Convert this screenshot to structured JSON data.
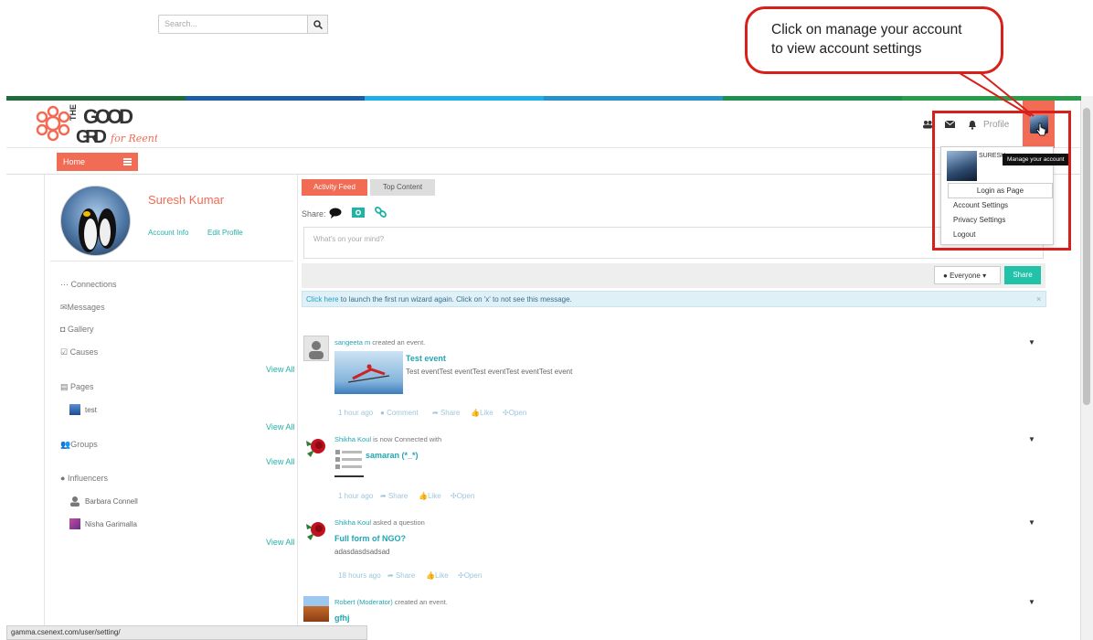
{
  "callout": {
    "line1": "Click on manage your account",
    "line2": "to view account settings"
  },
  "brand": {
    "accent": "#f26b55",
    "teal": "#21b2a6",
    "topbar_colors": [
      "#1f7a3f",
      "#1a5fa0",
      "#1db0e6",
      "#22a0c6",
      "#1f8f4f",
      "#26a14c"
    ]
  },
  "header": {
    "search_placeholder": "Search...",
    "profile_label": "Profile",
    "icons": [
      "users-icon",
      "envelope-icon",
      "bell-icon"
    ]
  },
  "nav": {
    "home_label": "Home"
  },
  "user": {
    "name": "Suresh Kumar",
    "account_info": "Account Info",
    "edit_profile": "Edit Profile"
  },
  "sidebar": {
    "connections": "Connections",
    "messages": "Messages",
    "gallery": "Gallery",
    "causes": "Causes",
    "view_all": "View All",
    "pages": "Pages",
    "page_item": "test",
    "groups": "Groups",
    "influencers": "Influencers",
    "influencer_1": "Barbara Connell",
    "influencer_2": "Nisha Garimalla"
  },
  "tabs": {
    "activity": "Activity Feed",
    "top": "Top Content"
  },
  "composer": {
    "share_label": "Share:",
    "placeholder": "What's on your mind?",
    "audience": "Everyone",
    "share_button": "Share"
  },
  "alert": {
    "link": "Click here",
    "text": " to launch the first run wizard again. Click on 'x' to not see this message.",
    "close": "×"
  },
  "feed": [
    {
      "user": "sangeeta m",
      "action": " created an event.",
      "title": "Test event",
      "text": "Test eventTest eventTest eventTest eventTest event",
      "time": "1 hour ago",
      "comment": "Comment",
      "share": "Share",
      "like": "Like",
      "open": "Open"
    },
    {
      "user": "Shikha Koul",
      "action": " is now Connected with",
      "title": "samaran (*_*)",
      "time": "1 hour ago",
      "share": "Share",
      "like": "Like",
      "open": "Open"
    },
    {
      "user": "Shikha Koul",
      "action": " asked a question",
      "title": "Full form of NGO?",
      "text": "adasdasdsadsad",
      "time": "18 hours ago",
      "share": "Share",
      "like": "Like",
      "open": "Open"
    },
    {
      "user": "Robert (Moderator)",
      "action": " created an event.",
      "title": "gfhj"
    }
  ],
  "dropdown": {
    "name": "SURESH",
    "tooltip": "Manage your account",
    "login_as_page": "Login as Page",
    "account_settings": "Account Settings",
    "privacy_settings": "Privacy Settings",
    "logout": "Logout"
  },
  "status_url": "gamma.csenext.com/user/setting/"
}
